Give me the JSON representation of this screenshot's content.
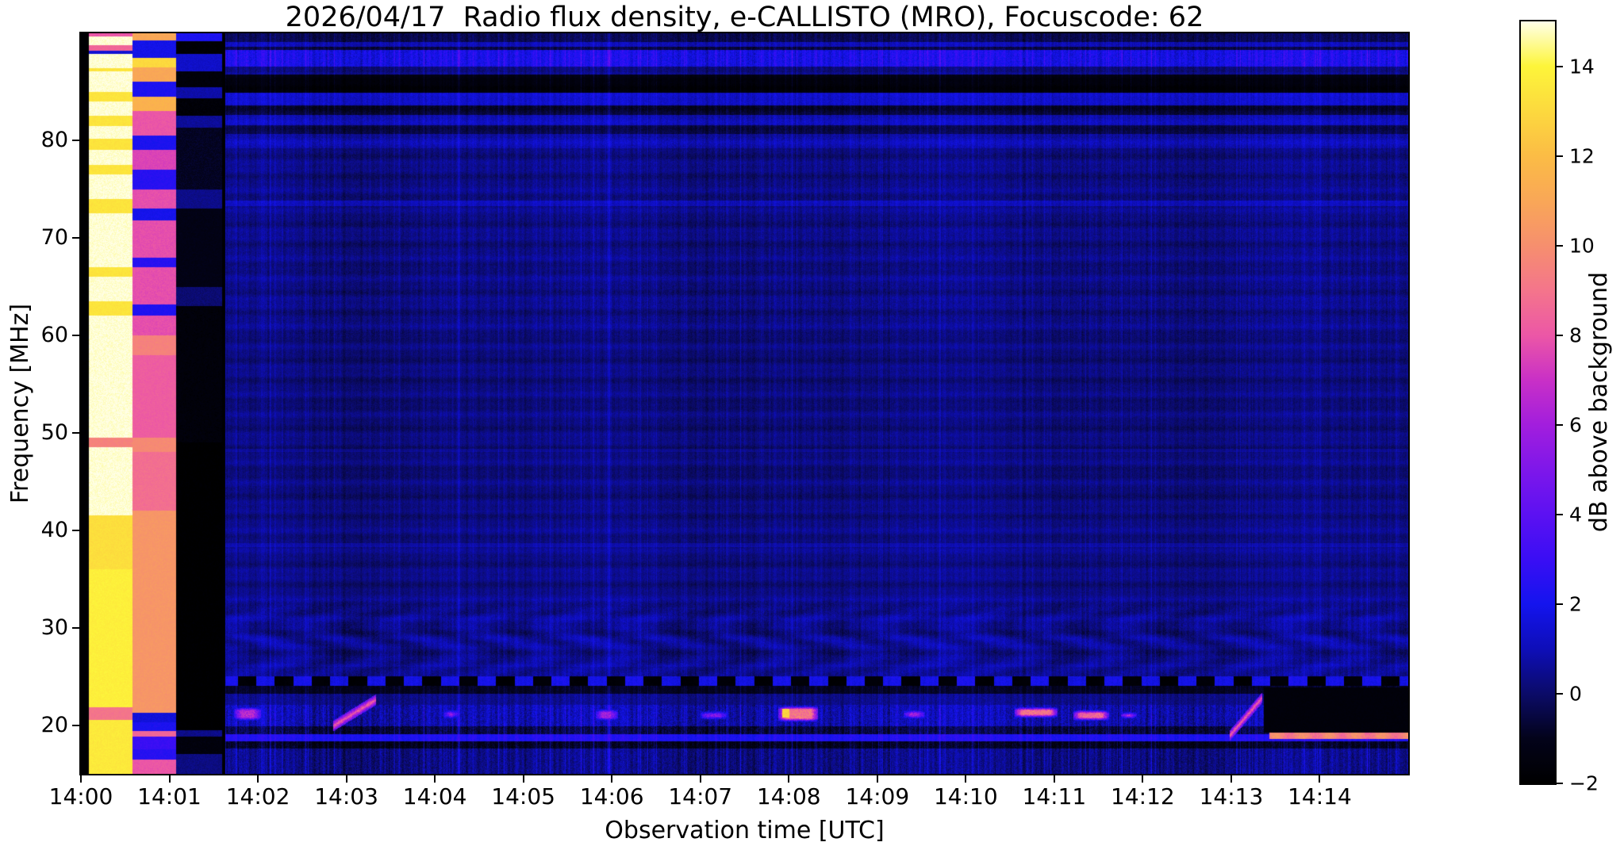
{
  "chart_data": {
    "type": "heatmap",
    "title": "2026/04/17  Radio flux density, e-CALLISTO (MRO), Focuscode: 62",
    "xlabel": "Observation time [UTC]",
    "ylabel": "Frequency [MHz]",
    "colorbar_label": "dB above background",
    "x_ticks": [
      "14:00",
      "14:01",
      "14:02",
      "14:03",
      "14:04",
      "14:05",
      "14:06",
      "14:07",
      "14:08",
      "14:09",
      "14:10",
      "14:11",
      "14:12",
      "14:13",
      "14:14"
    ],
    "x_span_min": 15,
    "duration_s": 900,
    "y_ticks": [
      20,
      30,
      40,
      50,
      60,
      70,
      80
    ],
    "freq_range_mhz": [
      15,
      91
    ],
    "value_range_db": [
      -2,
      15
    ],
    "colorbar_tick_values": [
      -2,
      0,
      2,
      4,
      6,
      8,
      10,
      12,
      14
    ],
    "colorbar_tick_labels": [
      "−2",
      "0",
      "2",
      "4",
      "6",
      "8",
      "10",
      "12",
      "14"
    ],
    "colormap_stops": [
      [
        -2,
        "#000000"
      ],
      [
        -1,
        "#03031a"
      ],
      [
        0,
        "#0b0b68"
      ],
      [
        1,
        "#0e0eb8"
      ],
      [
        2,
        "#1414ee"
      ],
      [
        3,
        "#3a0ef4"
      ],
      [
        4,
        "#5c11f2"
      ],
      [
        5,
        "#7e17ea"
      ],
      [
        6,
        "#a21edd"
      ],
      [
        7,
        "#c930c6"
      ],
      [
        8,
        "#ec57a6"
      ],
      [
        9,
        "#f4758b"
      ],
      [
        10,
        "#f68f6e"
      ],
      [
        11,
        "#f9a757"
      ],
      [
        12,
        "#fbbc45"
      ],
      [
        13,
        "#fcd93e"
      ],
      [
        14,
        "#fdf53a"
      ],
      [
        15,
        "#ffffe8"
      ]
    ],
    "background_bands": [
      [
        90.1,
        91.01,
        -0.3,
        0.8
      ],
      [
        89.6,
        90.1,
        1.0,
        0.9
      ],
      [
        89.3,
        89.6,
        -0.5,
        0.8
      ],
      [
        87.6,
        89.3,
        2.0,
        1.6
      ],
      [
        86.8,
        87.6,
        0.2,
        0.8
      ],
      [
        84.9,
        86.8,
        -1.5,
        0.5
      ],
      [
        83.6,
        84.9,
        1.2,
        0.9
      ],
      [
        82.6,
        83.6,
        -0.6,
        0.7
      ],
      [
        81.6,
        82.6,
        0.9,
        0.9
      ],
      [
        80.7,
        81.6,
        -0.3,
        0.7
      ],
      [
        79.2,
        80.7,
        0.8,
        0.9
      ],
      [
        73.3,
        73.8,
        1.2,
        0.8
      ],
      [
        60,
        79.2,
        0.3,
        0.8
      ],
      [
        48,
        48.4,
        0.7,
        0.6
      ],
      [
        42,
        60,
        0.2,
        0.7
      ],
      [
        38.3,
        38.7,
        0.9,
        0.6
      ],
      [
        33,
        42,
        0.3,
        0.7
      ],
      [
        26.2,
        33,
        0.45,
        0.9
      ],
      [
        25.0,
        26.2,
        0.5,
        0.9
      ],
      [
        24.0,
        25.0,
        "dash",
        0.6
      ],
      [
        23.2,
        24.0,
        -0.9,
        0.6
      ],
      [
        22.1,
        23.2,
        0.4,
        0.9
      ],
      [
        19.9,
        22.1,
        0.9,
        1.7
      ],
      [
        19.1,
        19.9,
        -0.5,
        1.4
      ],
      [
        18.3,
        19.1,
        2.3,
        0.9
      ],
      [
        17.6,
        18.3,
        -1.0,
        1.2
      ],
      [
        14.9,
        17.6,
        0.35,
        1.3
      ]
    ],
    "moire": {
      "f": [
        23.5,
        33.5
      ],
      "amp": 0.4,
      "period_s": 55
    },
    "dash_band": {
      "f": [
        24.0,
        25.0
      ],
      "period_s": 25,
      "on_db": 1.9,
      "off_db": -1.75
    },
    "calibration": {
      "lead_black_s": [
        0,
        5.5
      ],
      "data_start_s": 98,
      "columns": [
        {
          "t": [
            5.5,
            35
          ],
          "bands": [
            [
              15,
              20.5,
              13.6
            ],
            [
              20.5,
              21.8,
              9.0
            ],
            [
              21.8,
              36,
              13.8
            ],
            [
              36,
              41.5,
              13.2
            ],
            [
              41.5,
              48.5,
              14.9
            ],
            [
              48.5,
              49.5,
              9.5
            ],
            [
              49.5,
              62,
              14.9
            ],
            [
              62,
              63.5,
              13.4
            ],
            [
              63.5,
              66,
              14.9
            ],
            [
              66,
              67,
              13.4
            ],
            [
              67,
              72.5,
              14.9
            ],
            [
              72.5,
              74,
              13.4
            ],
            [
              74,
              76.5,
              14.9
            ],
            [
              76.5,
              77.5,
              13.4
            ],
            [
              77.5,
              79,
              14.9
            ],
            [
              79,
              80.2,
              13.4
            ],
            [
              80.2,
              81.5,
              14.9
            ],
            [
              81.5,
              82.5,
              13.4
            ],
            [
              82.5,
              84,
              14.9
            ],
            [
              84,
              85,
              13.4
            ],
            [
              85,
              87.1,
              14.9
            ],
            [
              87.1,
              87.4,
              13.4
            ],
            [
              87.4,
              88.9,
              14.9
            ],
            [
              88.9,
              89.2,
              1.5
            ],
            [
              89.2,
              89.8,
              8.5
            ],
            [
              89.8,
              90.7,
              14.9
            ],
            [
              90.7,
              91.01,
              8.0
            ]
          ]
        },
        {
          "t": [
            35,
            64.5
          ],
          "bands": [
            [
              15,
              16.5,
              8.0
            ],
            [
              16.5,
              17.5,
              2.5
            ],
            [
              17.5,
              18.8,
              3.0
            ],
            [
              18.8,
              19.4,
              8.5
            ],
            [
              19.4,
              20.3,
              2.2
            ],
            [
              20.3,
              21.3,
              1.6
            ],
            [
              21.3,
              42,
              10.3
            ],
            [
              42,
              48,
              8.8
            ],
            [
              48,
              49.5,
              9.8
            ],
            [
              49.5,
              58,
              8.2
            ],
            [
              58,
              60,
              9.5
            ],
            [
              60,
              62,
              7.8
            ],
            [
              62,
              63.2,
              2.3
            ],
            [
              63.2,
              67,
              7.8
            ],
            [
              67,
              68,
              2.5
            ],
            [
              68,
              71.8,
              7.8
            ],
            [
              71.8,
              73,
              2.0
            ],
            [
              73,
              75,
              7.8
            ],
            [
              75,
              77,
              2.5
            ],
            [
              77,
              79,
              7.5
            ],
            [
              79,
              80.5,
              2.2
            ],
            [
              80.5,
              83,
              8.0
            ],
            [
              83,
              84.5,
              11.5
            ],
            [
              84.5,
              86,
              2.2
            ],
            [
              86,
              87.5,
              11.0
            ],
            [
              87.5,
              88.5,
              13.0
            ],
            [
              88.5,
              90.3,
              1.9
            ],
            [
              90.3,
              91.01,
              11.0
            ]
          ]
        },
        {
          "t": [
            64.5,
            95.5
          ],
          "bands": [
            [
              15,
              17,
              0.3
            ],
            [
              17,
              18.8,
              -1.5
            ],
            [
              18.8,
              19.5,
              0.4
            ],
            [
              19.5,
              49,
              -2.0
            ],
            [
              49,
              63,
              -1.6
            ],
            [
              63,
              65,
              0.1
            ],
            [
              65,
              73,
              -1.2
            ],
            [
              73,
              75,
              0.4
            ],
            [
              75,
              81.3,
              -0.9
            ],
            [
              81.3,
              82.5,
              0.6
            ],
            [
              82.5,
              84.3,
              -1.7
            ],
            [
              84.3,
              85.5,
              0.8
            ],
            [
              85.5,
              87.1,
              -1.6
            ],
            [
              87.1,
              88.9,
              1.3
            ],
            [
              88.9,
              90.2,
              -1.8
            ],
            [
              90.2,
              91.01,
              2.2
            ]
          ]
        }
      ]
    },
    "bursts": [
      {
        "t": [
          104,
          122
        ],
        "f": [
          20.4,
          21.9
        ],
        "db": 6.5,
        "kind": "patch"
      },
      {
        "t": [
          171,
          200
        ],
        "f": [
          19.9,
          22.6
        ],
        "db": 8.5,
        "kind": "drift"
      },
      {
        "t": [
          246,
          256
        ],
        "f": [
          20.6,
          21.6
        ],
        "db": 5.5,
        "kind": "patch"
      },
      {
        "t": [
          349,
          364
        ],
        "f": [
          20.4,
          21.7
        ],
        "db": 6.0,
        "kind": "patch"
      },
      {
        "t": [
          420,
          438
        ],
        "f": [
          20.5,
          21.5
        ],
        "db": 5.0,
        "kind": "patch"
      },
      {
        "t": [
          473,
          500
        ],
        "f": [
          20.3,
          22.0
        ],
        "db": 9.0,
        "kind": "patch",
        "hot": true
      },
      {
        "t": [
          558,
          572
        ],
        "f": [
          20.6,
          21.6
        ],
        "db": 6.0,
        "kind": "patch"
      },
      {
        "t": [
          633,
          662
        ],
        "f": [
          20.7,
          21.9
        ],
        "db": 9.0,
        "kind": "patch"
      },
      {
        "t": [
          673,
          697
        ],
        "f": [
          20.4,
          21.6
        ],
        "db": 8.5,
        "kind": "patch"
      },
      {
        "t": [
          705,
          716
        ],
        "f": [
          20.6,
          21.4
        ],
        "db": 7.0,
        "kind": "patch"
      },
      {
        "t": [
          779,
          801
        ],
        "f": [
          18.9,
          22.8
        ],
        "db": 8.5,
        "kind": "drift"
      },
      {
        "t": [
          802,
          900
        ],
        "f": [
          19.2,
          23.9
        ],
        "db": -2.0,
        "kind": "quiet"
      },
      {
        "t": [
          806,
          900
        ],
        "f": [
          18.6,
          19.2
        ],
        "db": 9.5,
        "kind": "line"
      }
    ],
    "stripes": {
      "amp": 0.45,
      "strong_amp": 1.6,
      "strong_prob": 0.13
    }
  }
}
